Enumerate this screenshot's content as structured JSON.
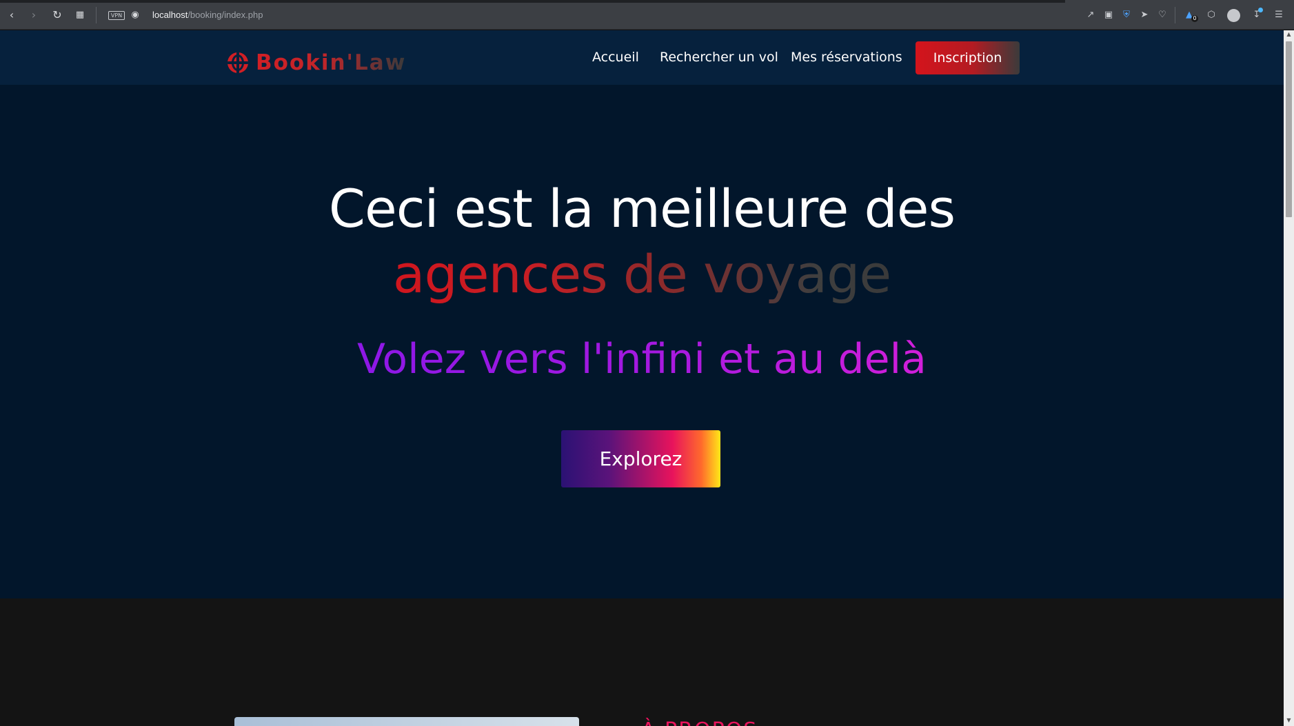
{
  "browser": {
    "url_host": "localhost",
    "url_path": "/booking/index.php",
    "vpn_label": "VPN",
    "back_icon": "chevron-left-icon",
    "forward_icon": "chevron-right-icon",
    "reload_icon": "reload-icon",
    "tabs_icon": "grid-icon",
    "extensions": [
      "share-icon",
      "camera-icon",
      "shield-icon",
      "send-icon",
      "heart-icon",
      "wallet-icon",
      "cube-icon",
      "profile-icon",
      "download-icon",
      "menu-icon"
    ],
    "wallet_badge": "0"
  },
  "nav": {
    "brand": "Bookin'Law",
    "links": [
      "Accueil",
      "Rechercher un vol",
      "Mes réservations"
    ],
    "cta": "Inscription"
  },
  "hero": {
    "title_line1": "Ceci est la meilleure des",
    "title_line2": "agences de voyage",
    "subtitle": "Volez vers l'infini et au delà",
    "button": "Explorez"
  },
  "about": {
    "title": "À PROPOS"
  },
  "colors": {
    "nav_bg": "#06213d",
    "hero_bg": "#02162b",
    "section_bg": "#141414",
    "brand_red": "#d11f25",
    "accent_pink": "#e8135c",
    "subtitle_purple": "#a419e0"
  }
}
